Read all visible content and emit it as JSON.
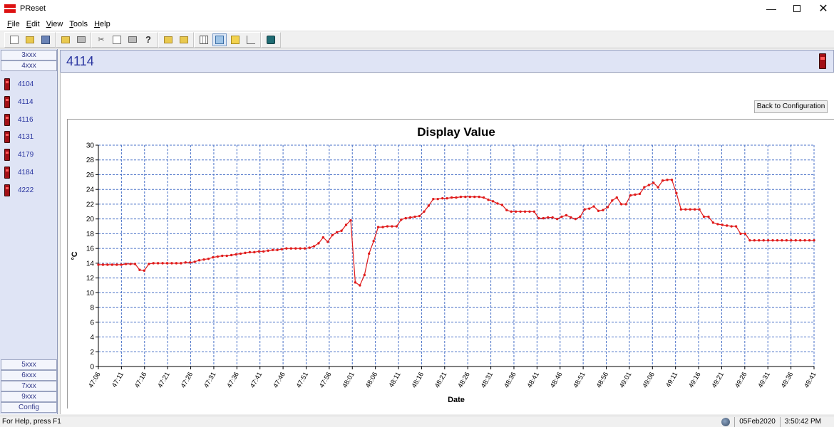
{
  "window": {
    "title": "PReset",
    "minimize_glyph": "—",
    "close_glyph": "✕"
  },
  "menu": [
    "File",
    "Edit",
    "View",
    "Tools",
    "Help"
  ],
  "toolbar_icons": [
    "new-file-icon",
    "open-folder-icon",
    "save-icon",
    "import-icon",
    "print-icon",
    "cut-icon",
    "copy-icon",
    "paste-icon",
    "help-icon",
    "folder-up-icon",
    "folder-new-icon",
    "table-view-icon",
    "chart-view-icon",
    "grid-view-icon",
    "axis-view-icon",
    "device-icon"
  ],
  "sidebar": {
    "top_groups": [
      "3xxx",
      "4xxx"
    ],
    "devices": [
      "4104",
      "4114",
      "4116",
      "4131",
      "4179",
      "4184",
      "4222"
    ],
    "bottom_groups": [
      "5xxx",
      "6xxx",
      "7xxx",
      "9xxx",
      "Config"
    ]
  },
  "main": {
    "title": "4114",
    "back_button": "Back to Configuration"
  },
  "status": {
    "help_text": "For Help, press F1",
    "date": "05Feb2020",
    "time": "3:50:42 PM"
  },
  "colors": {
    "series": "#e01b1b",
    "grid": "#4a72c8",
    "sidebar_bg": "#dfe4f5",
    "accent_text": "#2a35a0"
  },
  "chart_data": {
    "type": "line",
    "title": "Display Value",
    "xlabel": "Date",
    "ylabel": "°C",
    "ylim": [
      0,
      30
    ],
    "y_ticks": [
      0,
      2,
      4,
      6,
      8,
      10,
      12,
      14,
      16,
      18,
      20,
      22,
      24,
      26,
      28,
      30
    ],
    "x_ticks": [
      "47:06",
      "47:11",
      "47:16",
      "47:21",
      "47:26",
      "47:31",
      "47:36",
      "47:41",
      "47:46",
      "47:51",
      "47:56",
      "48:01",
      "48:06",
      "48:11",
      "48:16",
      "48:21",
      "48:26",
      "48:31",
      "48:36",
      "48:41",
      "48:46",
      "48:51",
      "48:56",
      "49:01",
      "49:06",
      "49:11",
      "49:16",
      "49:21",
      "49:26",
      "49:31",
      "49:36",
      "49:41"
    ],
    "grid": true,
    "series": [
      {
        "values": [
          13.8,
          13.8,
          13.8,
          13.8,
          13.8,
          13.8,
          13.9,
          13.9,
          13.9,
          13.1,
          13.0,
          13.9,
          14.0,
          14.0,
          14.0,
          14.0,
          14.0,
          14.0,
          14.0,
          14.1,
          14.1,
          14.2,
          14.4,
          14.5,
          14.6,
          14.8,
          14.9,
          15.0,
          15.0,
          15.1,
          15.2,
          15.3,
          15.4,
          15.5,
          15.5,
          15.6,
          15.6,
          15.7,
          15.8,
          15.8,
          15.9,
          16.0,
          16.0,
          16.0,
          16.0,
          16.0,
          16.1,
          16.3,
          16.7,
          17.5,
          16.9,
          17.8,
          18.2,
          18.4,
          19.2,
          19.8,
          11.4,
          11.0,
          12.4,
          15.3,
          17.0,
          18.9,
          18.9,
          19.0,
          19.0,
          19.0,
          19.9,
          20.1,
          20.2,
          20.3,
          20.4,
          21.0,
          21.8,
          22.7,
          22.7,
          22.8,
          22.8,
          22.9,
          22.9,
          23.0,
          23.0,
          23.0,
          23.0,
          23.0,
          22.9,
          22.6,
          22.4,
          22.1,
          21.9,
          21.2,
          21.0,
          21.0,
          21.0,
          21.0,
          21.0,
          21.0,
          20.1,
          20.1,
          20.2,
          20.2,
          20.0,
          20.3,
          20.5,
          20.2,
          20.0,
          20.3,
          21.3,
          21.4,
          21.7,
          21.1,
          21.2,
          21.6,
          22.5,
          22.9,
          22.0,
          22.0,
          23.2,
          23.3,
          23.4,
          24.3,
          24.6,
          24.9,
          24.3,
          25.2,
          25.3,
          25.3,
          23.5,
          21.3,
          21.3,
          21.3,
          21.3,
          21.3,
          20.3,
          20.3,
          19.5,
          19.3,
          19.2,
          19.1,
          19.0,
          19.0,
          18.0,
          18.0,
          17.1,
          17.1,
          17.1,
          17.1,
          17.1,
          17.1,
          17.1,
          17.1,
          17.1,
          17.1,
          17.1,
          17.1,
          17.1,
          17.1,
          17.1
        ]
      }
    ]
  }
}
